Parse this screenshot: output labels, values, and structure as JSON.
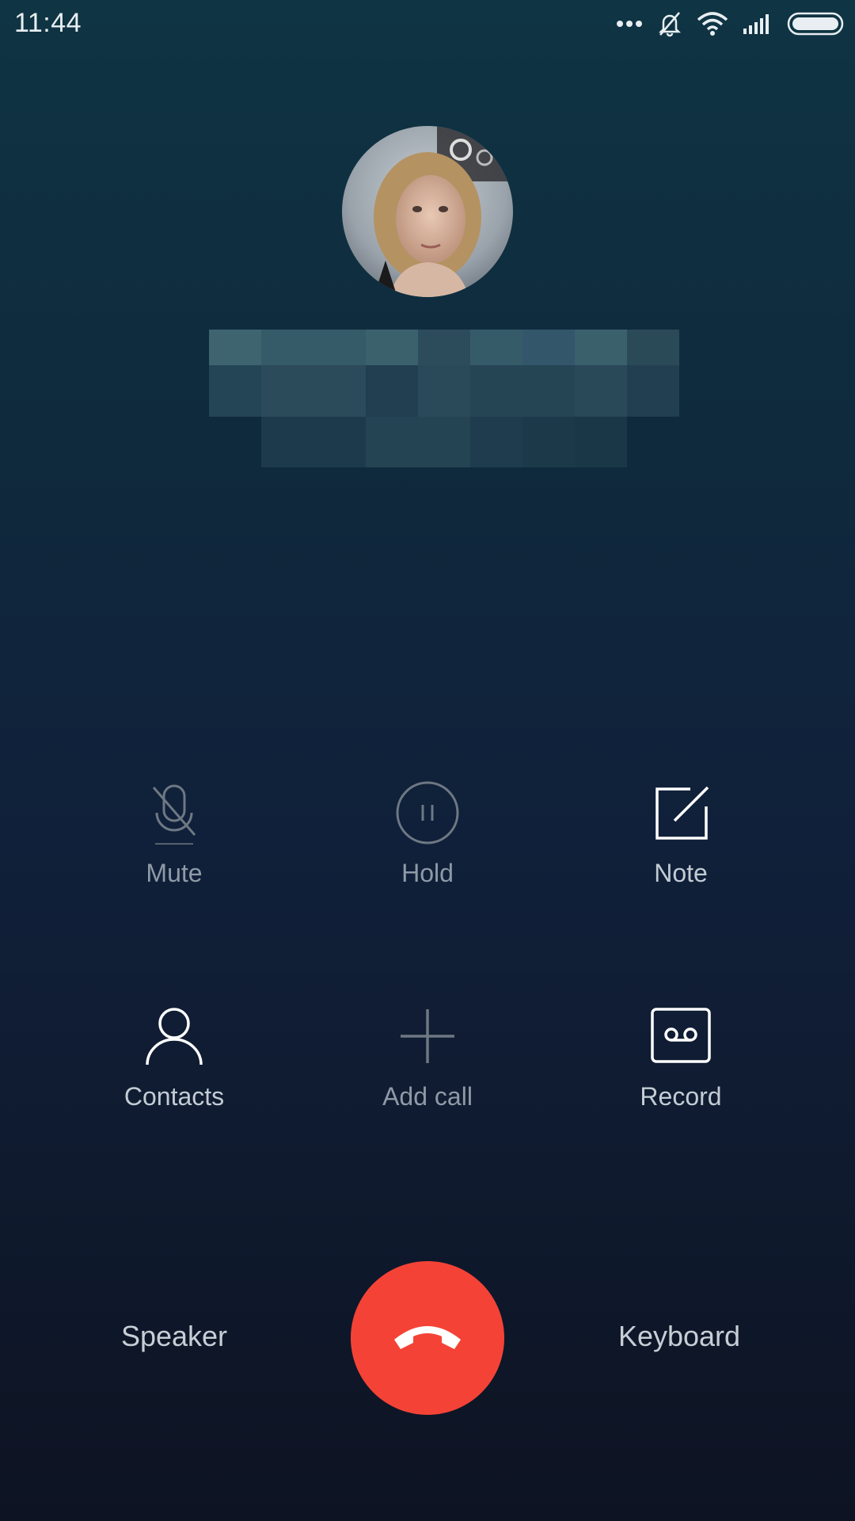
{
  "status_bar": {
    "time": "11:44",
    "icons": [
      "more-dots-icon",
      "bell-off-icon",
      "wifi-icon",
      "signal-icon",
      "battery-icon"
    ]
  },
  "caller": {
    "avatar_icon": "contact-photo",
    "name_obscured": true
  },
  "controls": {
    "mute": {
      "label": "Mute",
      "icon": "mic-off-icon",
      "enabled": false
    },
    "hold": {
      "label": "Hold",
      "icon": "pause-circle-icon",
      "enabled": false
    },
    "note": {
      "label": "Note",
      "icon": "note-edit-icon",
      "enabled": true
    },
    "contacts": {
      "label": "Contacts",
      "icon": "person-icon",
      "enabled": true
    },
    "add_call": {
      "label": "Add call",
      "icon": "plus-icon",
      "enabled": false
    },
    "record": {
      "label": "Record",
      "icon": "voicemail-tape-icon",
      "enabled": true
    }
  },
  "bottom": {
    "speaker_label": "Speaker",
    "keyboard_label": "Keyboard",
    "end_call_icon": "phone-hangup-icon"
  },
  "colors": {
    "end_call": "#f44336",
    "background_top": "#0f3443",
    "background_bottom": "#0d1322"
  }
}
